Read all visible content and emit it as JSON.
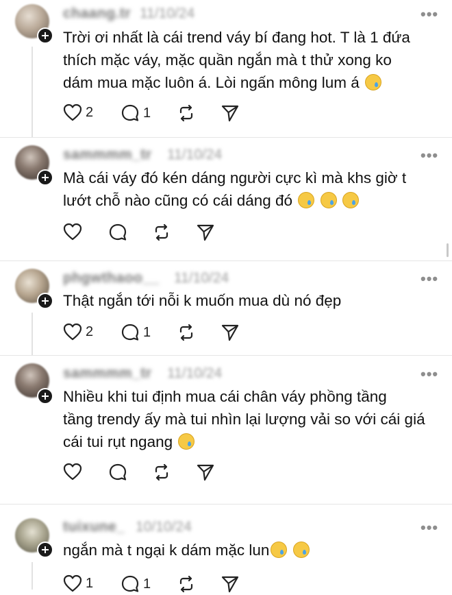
{
  "posts": [
    {
      "username": "chaang.tr",
      "date": "11/10/24",
      "more": "•••",
      "text_lines": [
        "Trời ơi nhất là cái trend váy bí đang hot. T là 1 đứa",
        "thích mặc váy, mặc quần ngắn mà t thử xong ko",
        "dám mua mặc luôn á. Lòi ngấn mông lum á"
      ],
      "emojis": 1,
      "likes": "2",
      "replies": "1"
    },
    {
      "username": "sammmm_tr",
      "date": "11/10/24",
      "more": "•••",
      "text_lines": [
        "Mà cái váy đó kén dáng người cực kì mà khs giờ t",
        "lướt chỗ nào cũng có cái dáng đó"
      ],
      "emojis": 3,
      "likes": "",
      "replies": ""
    },
    {
      "username": "phgwthaoo__",
      "date": "11/10/24",
      "more": "•••",
      "text_lines": [
        "Thật ngắn tới nỗi k muốn mua dù nó đẹp"
      ],
      "emojis": 0,
      "likes": "2",
      "replies": "1"
    },
    {
      "username": "sammmm_tr",
      "date": "11/10/24",
      "more": "•••",
      "text_lines": [
        "Nhiều khi tui định mua cái chân váy phồng tầng",
        "tầng trendy ấy mà tui nhìn lại lượng vải so với cái giá",
        "cái tui rụt ngang"
      ],
      "emojis": 1,
      "likes": "",
      "replies": ""
    },
    {
      "username": "tuixune_",
      "date": "10/10/24",
      "more": "•••",
      "text_lines": [
        "ngắn mà t ngại k dám mặc lun"
      ],
      "emojis": 2,
      "likes": "1",
      "replies": "1"
    }
  ],
  "icons": {
    "like": "heart-icon",
    "reply": "comment-bubble-icon",
    "repost": "repost-icon",
    "share": "send-icon",
    "follow": "plus-icon"
  }
}
